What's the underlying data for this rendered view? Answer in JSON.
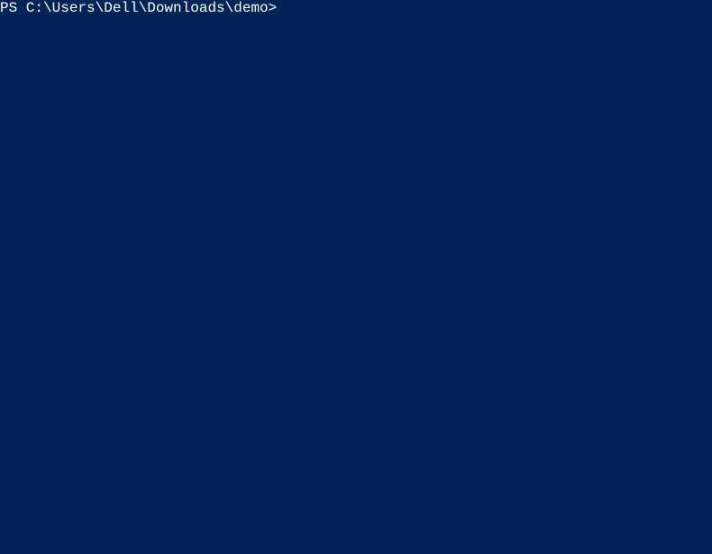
{
  "terminal": {
    "prompt": "PS C:\\Users\\Dell\\Downloads\\demo>",
    "command_value": ""
  },
  "colors": {
    "background": "#012456",
    "foreground": "#ffffff"
  }
}
